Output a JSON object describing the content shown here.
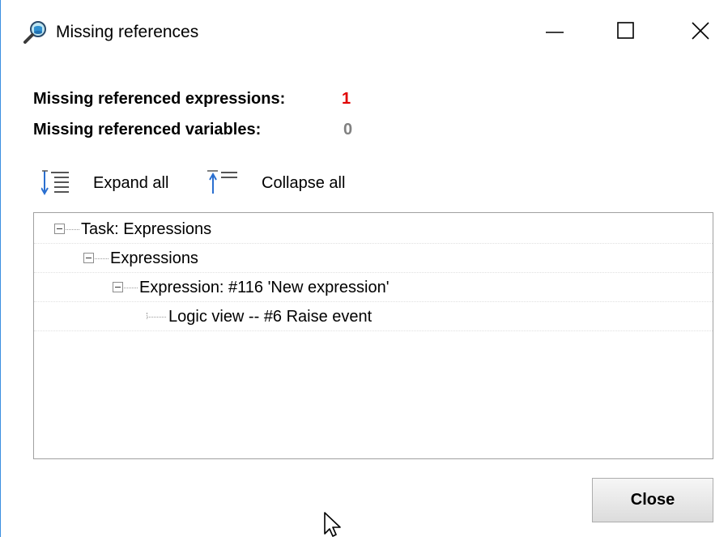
{
  "window": {
    "title": "Missing references"
  },
  "summary": {
    "expressions_label": "Missing referenced expressions:",
    "expressions_count": "1",
    "expressions_count_color": "#e00000",
    "variables_label": "Missing referenced variables:",
    "variables_count": "0",
    "variables_count_color": "#808080"
  },
  "toolbar": {
    "expand_label": "Expand all",
    "collapse_label": "Collapse all",
    "icon_color": "#2a6fd0"
  },
  "tree": {
    "nodes": [
      {
        "label": "Task: Expressions",
        "expanded": true
      },
      {
        "label": "Expressions",
        "expanded": true
      },
      {
        "label": "Expression: #116  'New expression'",
        "expanded": true
      },
      {
        "label": "Logic view -- #6 Raise event"
      }
    ]
  },
  "footer": {
    "close_label": "Close"
  },
  "icons": {
    "app": "magnifier-database-icon",
    "minimize": "minimize-icon",
    "maximize": "maximize-icon",
    "close": "close-icon",
    "expand_all": "expand-all-icon",
    "collapse_all": "collapse-all-icon",
    "cursor": "mouse-pointer-icon"
  }
}
